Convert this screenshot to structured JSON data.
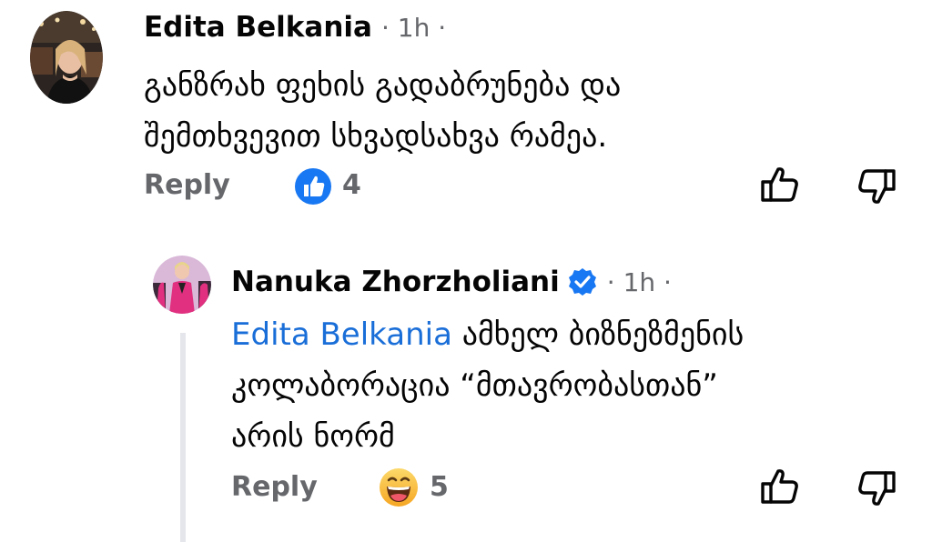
{
  "comments": [
    {
      "author": "Edita Belkania",
      "time": "1h",
      "lines": [
        "განზრახ ფეხის გადაბრუნება და",
        "შემთხვევით სხვადსახვა რამეა."
      ],
      "reply_label": "Reply",
      "reaction_icon": "like-reaction-icon",
      "reaction_count": "4"
    },
    {
      "author": "Nanuka Zhorzholiani",
      "verified": true,
      "time": "1h",
      "mention": "Edita Belkania",
      "line1_rest": " ამხელ ბიზნეზმენის",
      "lines_rest": [
        "კოლაბორაცია “მთავრობასთან”",
        "არის ნორმ"
      ],
      "reply_label": "Reply",
      "reaction_icon": "haha-reaction-icon",
      "reaction_count": "5"
    }
  ],
  "colors": {
    "text": "#050505",
    "secondary": "#65676b",
    "mention": "#1a6ed8",
    "like_blue": "#1877f2",
    "verified_blue": "#1877f2",
    "thread_line": "#e4e6eb"
  },
  "icons": [
    "thumbs-up-icon",
    "thumbs-down-icon",
    "verified-badge-icon",
    "more-dots"
  ]
}
